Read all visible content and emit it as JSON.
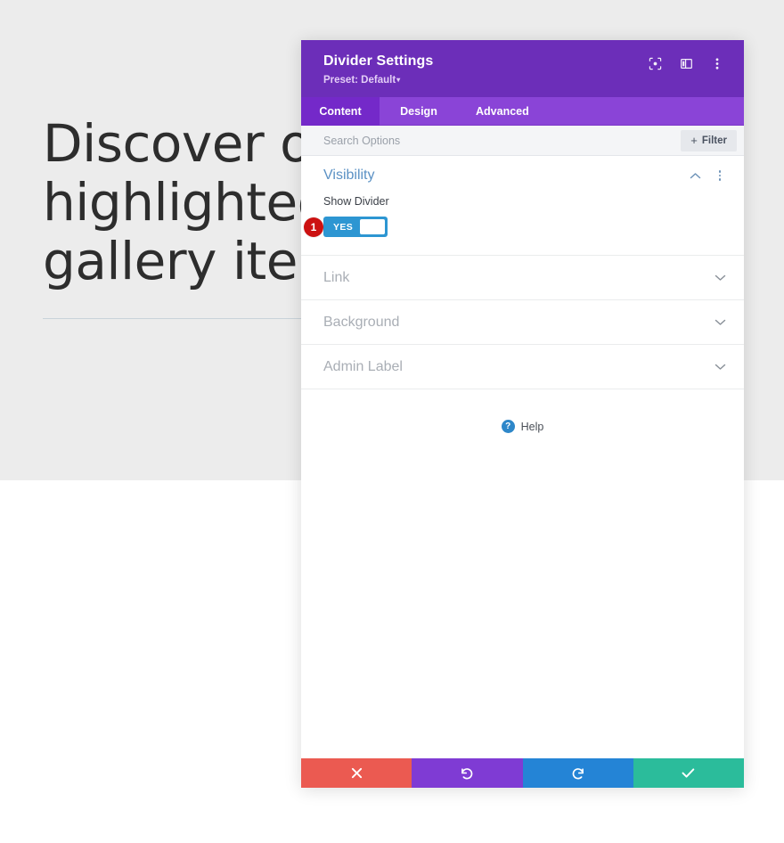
{
  "backdrop": {
    "heading": "Discover our\nhighlighted\ngallery items",
    "divider_name": "hero-divider"
  },
  "modal": {
    "title": "Divider Settings",
    "preset_label": "Preset: Default",
    "preset_caret": "▾",
    "header_icons": [
      {
        "name": "focus-target-icon",
        "title": "Focus"
      },
      {
        "name": "layout-panel-icon",
        "title": "Panel Layout"
      },
      {
        "name": "kebab-menu-icon",
        "title": "More Options"
      }
    ],
    "tabs": [
      {
        "label": "Content",
        "active": true
      },
      {
        "label": "Design",
        "active": false
      },
      {
        "label": "Advanced",
        "active": false
      }
    ],
    "search": {
      "placeholder": "Search Options",
      "value": ""
    },
    "filter_button": {
      "label": "Filter",
      "plus": "+"
    },
    "groups": [
      {
        "name": "visibility",
        "title": "Visibility",
        "open": true,
        "fields": [
          {
            "name": "show-divider",
            "label": "Show Divider",
            "type": "toggle",
            "value": "YES",
            "badge": "1"
          }
        ]
      },
      {
        "name": "link",
        "title": "Link",
        "open": false
      },
      {
        "name": "background",
        "title": "Background",
        "open": false
      },
      {
        "name": "admin-label",
        "title": "Admin Label",
        "open": false
      }
    ],
    "help": {
      "icon_glyph": "?",
      "label": "Help"
    },
    "footer_buttons": [
      {
        "name": "cancel-button",
        "icon": "close-icon",
        "glyph": "✖",
        "color": "#eb5a51"
      },
      {
        "name": "undo-button",
        "icon": "undo-icon",
        "glyph": "↺",
        "color": "#7f3bd4"
      },
      {
        "name": "redo-button",
        "icon": "redo-icon",
        "glyph": "↻",
        "color": "#2484d6"
      },
      {
        "name": "save-button",
        "icon": "checkmark-icon",
        "glyph": "✔",
        "color": "#2bbc9b"
      }
    ]
  },
  "colors": {
    "header_purple": "#6C2EB9",
    "tabbar_purple": "#8A44D7",
    "active_tab_purple": "#7429C9",
    "group_title_blue": "#5B91C4",
    "toggle_blue": "#2D96D2",
    "badge_red": "#CC1111",
    "cancel_red": "#EB5A51",
    "undo_purple": "#7F3BD4",
    "redo_blue": "#2484D6",
    "save_teal": "#2BBC9B",
    "page_gray": "#ECECEC"
  }
}
